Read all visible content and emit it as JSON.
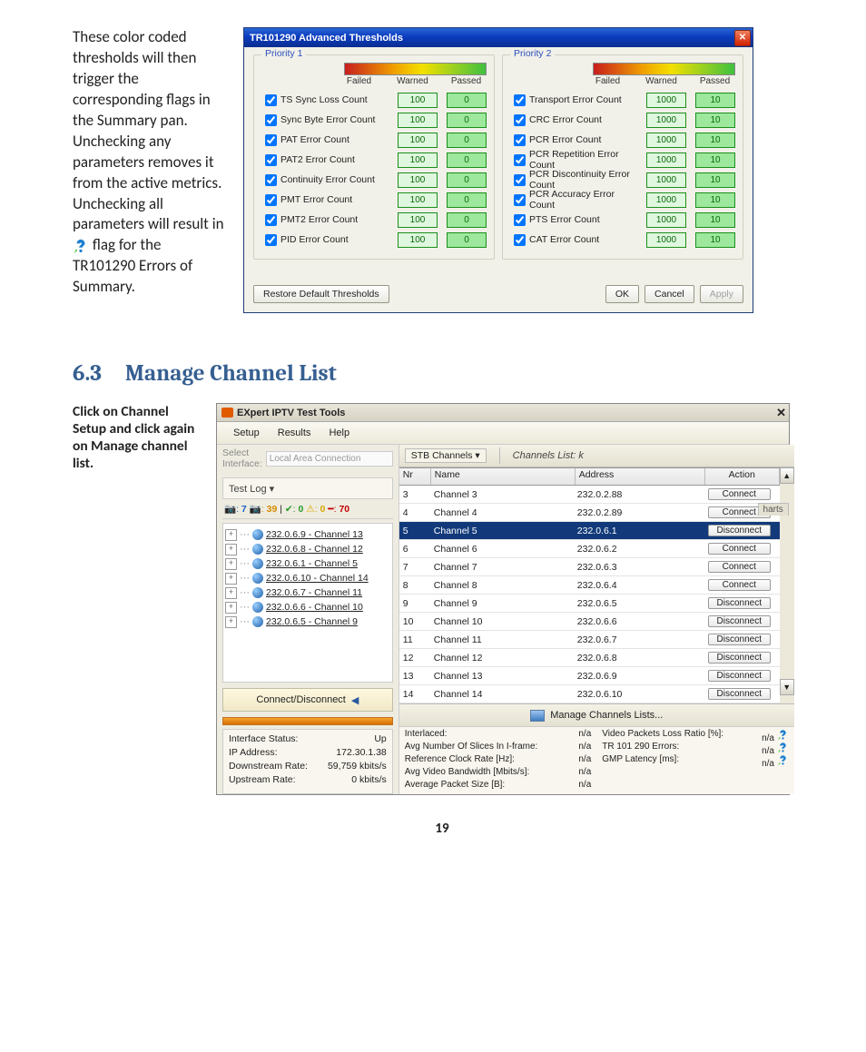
{
  "para1_a": "These color coded thresholds will then trigger the corresponding flags in the Summary pan. Unchecking any parameters removes it from the active metrics. Unchecking all parameters will result in ",
  "para1_b": " flag for the TR101290 Errors of Summary.",
  "dlg": {
    "title": "TR101290 Advanced Thresholds",
    "priority1": "Priority 1",
    "priority2": "Priority 2",
    "failed": "Failed",
    "warned": "Warned",
    "passed": "Passed",
    "p1": [
      {
        "n": "TS Sync Loss Count",
        "f": "100",
        "w": "0"
      },
      {
        "n": "Sync Byte Error Count",
        "f": "100",
        "w": "0"
      },
      {
        "n": "PAT Error Count",
        "f": "100",
        "w": "0"
      },
      {
        "n": "PAT2 Error Count",
        "f": "100",
        "w": "0"
      },
      {
        "n": "Continuity Error Count",
        "f": "100",
        "w": "0"
      },
      {
        "n": "PMT Error Count",
        "f": "100",
        "w": "0"
      },
      {
        "n": "PMT2 Error Count",
        "f": "100",
        "w": "0"
      },
      {
        "n": "PID Error Count",
        "f": "100",
        "w": "0"
      }
    ],
    "p2": [
      {
        "n": "Transport Error Count",
        "f": "1000",
        "w": "10"
      },
      {
        "n": "CRC Error Count",
        "f": "1000",
        "w": "10"
      },
      {
        "n": "PCR Error Count",
        "f": "1000",
        "w": "10"
      },
      {
        "n": "PCR Repetition Error Count",
        "f": "1000",
        "w": "10"
      },
      {
        "n": "PCR Discontinuity Error Count",
        "f": "1000",
        "w": "10"
      },
      {
        "n": "PCR Accuracy Error Count",
        "f": "1000",
        "w": "10"
      },
      {
        "n": "PTS Error Count",
        "f": "1000",
        "w": "10"
      },
      {
        "n": "CAT Error Count",
        "f": "1000",
        "w": "10"
      }
    ],
    "restore": "Restore Default Thresholds",
    "ok": "OK",
    "cancel": "Cancel",
    "apply": "Apply"
  },
  "heading_num": "6.3",
  "heading_txt": "Manage Channel List",
  "para2": "Click on Channel Setup and click again on Manage channel list.",
  "win": {
    "title": "EXpert IPTV Test Tools",
    "menu": [
      "Setup",
      "Results",
      "Help"
    ],
    "sel_iface_lbl": "Select Interface:",
    "sel_iface_val": "Local Area Connection",
    "testlog": "Test Log ▾",
    "counts": {
      "a": "7",
      "b": "39",
      "c": "0",
      "d": "0",
      "e": "70"
    },
    "tree": [
      "232.0.6.9 - Channel 13",
      "232.0.6.8 - Channel 12",
      "232.0.6.1 - Channel 5",
      "232.0.6.10 - Channel 14",
      "232.0.6.7 - Channel 11",
      "232.0.6.6 - Channel 10",
      "232.0.6.5 - Channel 9"
    ],
    "conn_disc": "Connect/Disconnect",
    "iface": [
      [
        "Interface Status:",
        "Up"
      ],
      [
        "IP Address:",
        "172.30.1.38"
      ],
      [
        "Downstream Rate:",
        "59,759 kbits/s"
      ],
      [
        "Upstream Rate:",
        "0 kbits/s"
      ]
    ],
    "stb": "STB Channels ▾",
    "chanlist": "Channels List:   k",
    "head": [
      "Nr",
      "Name",
      "Address",
      "Action"
    ],
    "rows": [
      {
        "nr": "3",
        "name": "Channel 3",
        "addr": "232.0.2.88",
        "act": "Connect",
        "sel": false
      },
      {
        "nr": "4",
        "name": "Channel 4",
        "addr": "232.0.2.89",
        "act": "Connect",
        "sel": false
      },
      {
        "nr": "5",
        "name": "Channel 5",
        "addr": "232.0.6.1",
        "act": "Disconnect",
        "sel": true
      },
      {
        "nr": "6",
        "name": "Channel 6",
        "addr": "232.0.6.2",
        "act": "Connect",
        "sel": false
      },
      {
        "nr": "7",
        "name": "Channel 7",
        "addr": "232.0.6.3",
        "act": "Connect",
        "sel": false
      },
      {
        "nr": "8",
        "name": "Channel 8",
        "addr": "232.0.6.4",
        "act": "Connect",
        "sel": false
      },
      {
        "nr": "9",
        "name": "Channel 9",
        "addr": "232.0.6.5",
        "act": "Disconnect",
        "sel": false
      },
      {
        "nr": "10",
        "name": "Channel 10",
        "addr": "232.0.6.6",
        "act": "Disconnect",
        "sel": false
      },
      {
        "nr": "11",
        "name": "Channel 11",
        "addr": "232.0.6.7",
        "act": "Disconnect",
        "sel": false
      },
      {
        "nr": "12",
        "name": "Channel 12",
        "addr": "232.0.6.8",
        "act": "Disconnect",
        "sel": false
      },
      {
        "nr": "13",
        "name": "Channel 13",
        "addr": "232.0.6.9",
        "act": "Disconnect",
        "sel": false
      },
      {
        "nr": "14",
        "name": "Channel 14",
        "addr": "232.0.6.10",
        "act": "Disconnect",
        "sel": false
      }
    ],
    "manage": "Manage Channels Lists...",
    "stats_left": [
      [
        "Interlaced:",
        "n/a"
      ],
      [
        "Avg Number Of Slices In I-frame:",
        "n/a"
      ],
      [
        "Reference Clock Rate [Hz]:",
        "n/a"
      ],
      [
        "Avg Video Bandwidth [Mbits/s]:",
        "n/a"
      ],
      [
        "Average Packet Size [B]:",
        "n/a"
      ]
    ],
    "stats_right": [
      [
        "Video Packets Loss Ratio [%]:",
        "n/a"
      ],
      [
        "TR 101 290 Errors:",
        "n/a"
      ],
      [
        "GMP Latency [ms]:",
        "n/a"
      ]
    ],
    "charts": "harts"
  },
  "pagenum": "19"
}
